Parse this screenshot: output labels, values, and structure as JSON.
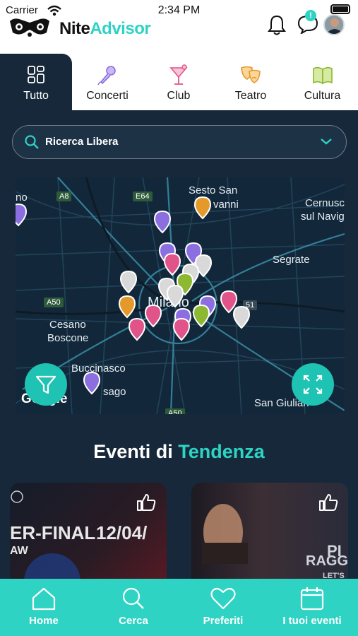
{
  "status_bar": {
    "carrier": "Carrier",
    "time": "2:34 PM"
  },
  "header": {
    "brand_part1": "Nite",
    "brand_part2": "Advisor",
    "chat_badge": "!"
  },
  "tabs": [
    {
      "label": "Tutto",
      "icon": "grid-icon",
      "active": true
    },
    {
      "label": "Concerti",
      "icon": "microphone-icon",
      "active": false
    },
    {
      "label": "Club",
      "icon": "cocktail-icon",
      "active": false
    },
    {
      "label": "Teatro",
      "icon": "theatre-masks-icon",
      "active": false
    },
    {
      "label": "Cultura",
      "icon": "book-icon",
      "active": false
    }
  ],
  "search": {
    "value": "Ricerca Libera"
  },
  "map": {
    "places": [
      "Sesto San",
      "vanni",
      "Cernusc",
      "sul Navig",
      "Segrate",
      "Cesano",
      "Boscone",
      "Buccinasco",
      "sago",
      "San Giulian",
      "Milano",
      "no"
    ],
    "roads": [
      "A8",
      "E64",
      "A50",
      "A50",
      "51"
    ],
    "attribution": "Google"
  },
  "trending": {
    "title_part1": "Eventi di ",
    "title_part2": "Tendenza",
    "cards": [
      {
        "text1": "ER-FINAL",
        "text2": "12/04/",
        "text3": "AW"
      },
      {
        "text1": "PI",
        "text2": "RAGG",
        "text3": "LET'S"
      }
    ]
  },
  "bottom_nav": [
    {
      "label": "Home",
      "icon": "home-icon"
    },
    {
      "label": "Cerca",
      "icon": "search-icon"
    },
    {
      "label": "Preferiti",
      "icon": "heart-icon"
    },
    {
      "label": "I tuoi eventi",
      "icon": "calendar-icon"
    }
  ],
  "colors": {
    "accent": "#2ed3c3",
    "background": "#17283b",
    "header": "#ffffff"
  }
}
